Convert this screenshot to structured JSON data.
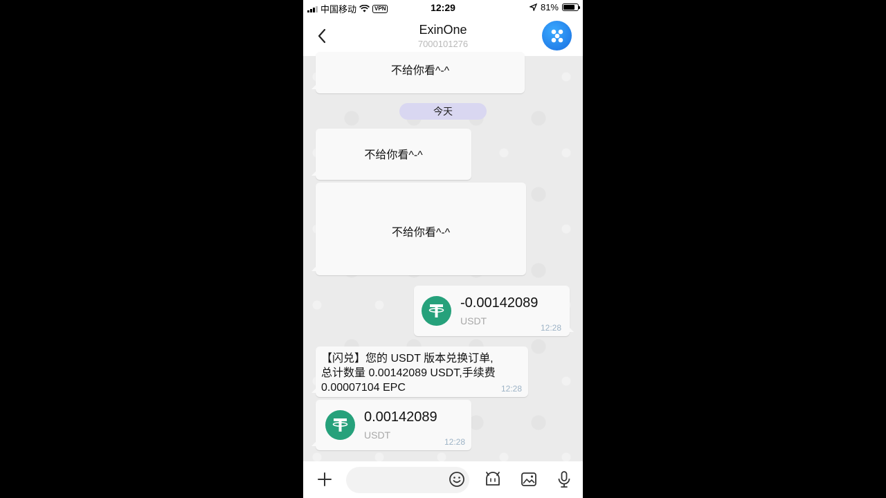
{
  "status_bar": {
    "carrier": "中国移动",
    "vpn": "VPN",
    "time": "12:29",
    "battery": "81%",
    "battery_level": 0.81
  },
  "header": {
    "title": "ExinOne",
    "subtitle": "7000101276",
    "back_icon": "chevron-left-icon",
    "avatar_icon": "exinone-logo-icon"
  },
  "messages": {
    "m1_text": "不给你看^-^",
    "date_chip": "今天",
    "m2_text": "不给你看^-^",
    "m3_text": "不给你看^-^",
    "transfer_out": {
      "amount": "-0.00142089",
      "unit": "USDT",
      "time": "12:28"
    },
    "system": {
      "line1": "【闪兑】您的 USDT 版本兑换订单,",
      "line2": "总计数量 0.00142089 USDT,手续费",
      "line3": "0.00007104 EPC",
      "time": "12:28"
    },
    "transfer_in": {
      "amount": "0.00142089",
      "unit": "USDT",
      "time": "12:28"
    }
  },
  "input_bar": {
    "placeholder": "",
    "icons": [
      "plus-icon",
      "emoji-icon",
      "sticker-icon",
      "image-icon",
      "microphone-icon"
    ]
  },
  "colors": {
    "usdt_green": "#26a17b",
    "date_chip": "#d9d7f1",
    "avatar_blue": "#2b8af5",
    "timestamp": "#9db3c6"
  }
}
